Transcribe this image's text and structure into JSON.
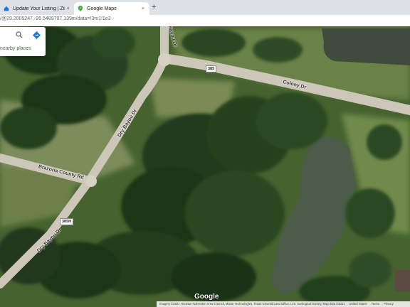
{
  "tabs": [
    {
      "label": "Update Your Listing | Zillow",
      "active": false,
      "icon": "zillow-icon"
    },
    {
      "label": "Google Maps",
      "active": true,
      "icon": "maps-pin-icon"
    }
  ],
  "new_tab": "+",
  "tab_close": "×",
  "address_bar": {
    "url": "/@29.2005247,-95.5489707,139m/data=!3m1!1e3"
  },
  "search_card": {
    "nearby": "nearby places"
  },
  "roads": {
    "colony": "Colony Dr",
    "brazoria": "Brazoria County Rd",
    "dry_bayou_1": "Dry Bayou Dr",
    "dry_bayou_2": "Dry Bayou Dr",
    "dry_bayou_3": "Dry Bayou Dr",
    "shield_385": "385",
    "shield_385h": "385H"
  },
  "google_logo": "Google",
  "footer": {
    "attribution": "Imagery ©2021 Houston-Galveston Area Council, Maxar Technologies, Texas General Land Office, U.S. Geological Survey, Map data ©2021",
    "region": "United States",
    "terms": "Terms",
    "privacy": "Privacy"
  },
  "colors": {
    "road": "#ccc7b8",
    "tree_dark": "#1e3417",
    "pond": "#4d5b4a"
  }
}
